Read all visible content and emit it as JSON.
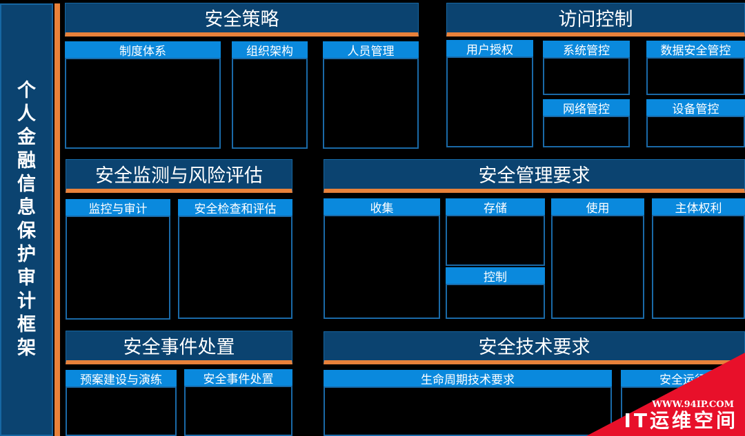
{
  "sidebar": {
    "title": "个人金融信息保护审计框架"
  },
  "sections": {
    "policy": {
      "title": "安全策略",
      "boxes": [
        "制度体系",
        "组织架构",
        "人员管理"
      ]
    },
    "access": {
      "title": "访问控制",
      "boxes": [
        "用户授权",
        "系统管控",
        "数据安全管控",
        "网络管控",
        "设备管控"
      ]
    },
    "monitor": {
      "title": "安全监测与风险评估",
      "boxes": [
        "监控与审计",
        "安全检查和评估"
      ]
    },
    "mgmt": {
      "title": "安全管理要求",
      "boxes": [
        "收集",
        "存储",
        "控制",
        "使用",
        "主体权利"
      ]
    },
    "incident": {
      "title": "安全事件处置",
      "boxes": [
        "预案建设与演练",
        "安全事件处置"
      ]
    },
    "tech": {
      "title": "安全技术要求",
      "boxes": [
        "生命周期技术要求",
        "安全运行"
      ]
    }
  },
  "watermark": {
    "url": "WWW.94IP.COM",
    "brand": "IT运维空间"
  },
  "colors": {
    "header_bg": "#0b4370",
    "box_head_bg": "#0a89dd",
    "accent": "#e8813a",
    "border": "#1a6aa8",
    "watermark": "#e8102a"
  }
}
